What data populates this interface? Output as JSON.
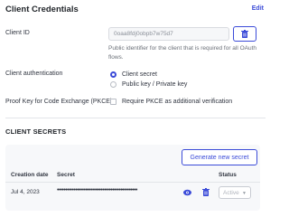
{
  "header": {
    "title": "Client Credentials",
    "edit_label": "Edit"
  },
  "client_id": {
    "label": "Client ID",
    "value": "0oaa8fdj0obpb7w75d7",
    "helper_text": "Public identifier for the client that is required for all OAuth flows.",
    "copy_icon": "trash-icon"
  },
  "client_auth": {
    "label": "Client authentication",
    "options": [
      {
        "label": "Client secret",
        "selected": true
      },
      {
        "label": "Public key / Private key",
        "selected": false
      }
    ]
  },
  "pkce": {
    "label": "Proof Key for Code Exchange (PKCE)",
    "checkbox_label": "Require PKCE as additional verification",
    "checked": false
  },
  "secrets": {
    "heading": "CLIENT SECRETS",
    "generate_label": "Generate new secret",
    "columns": {
      "created": "Creation date",
      "secret": "Secret",
      "status": "Status"
    },
    "rows": [
      {
        "created": "Jul 4, 2023",
        "secret": "••••••••••••••••••••••••••••••••••••••••••••••••",
        "status": "Active"
      }
    ]
  },
  "colors": {
    "accent": "#3b4bd8",
    "muted": "#6b7078",
    "border": "#d9dbe0"
  }
}
